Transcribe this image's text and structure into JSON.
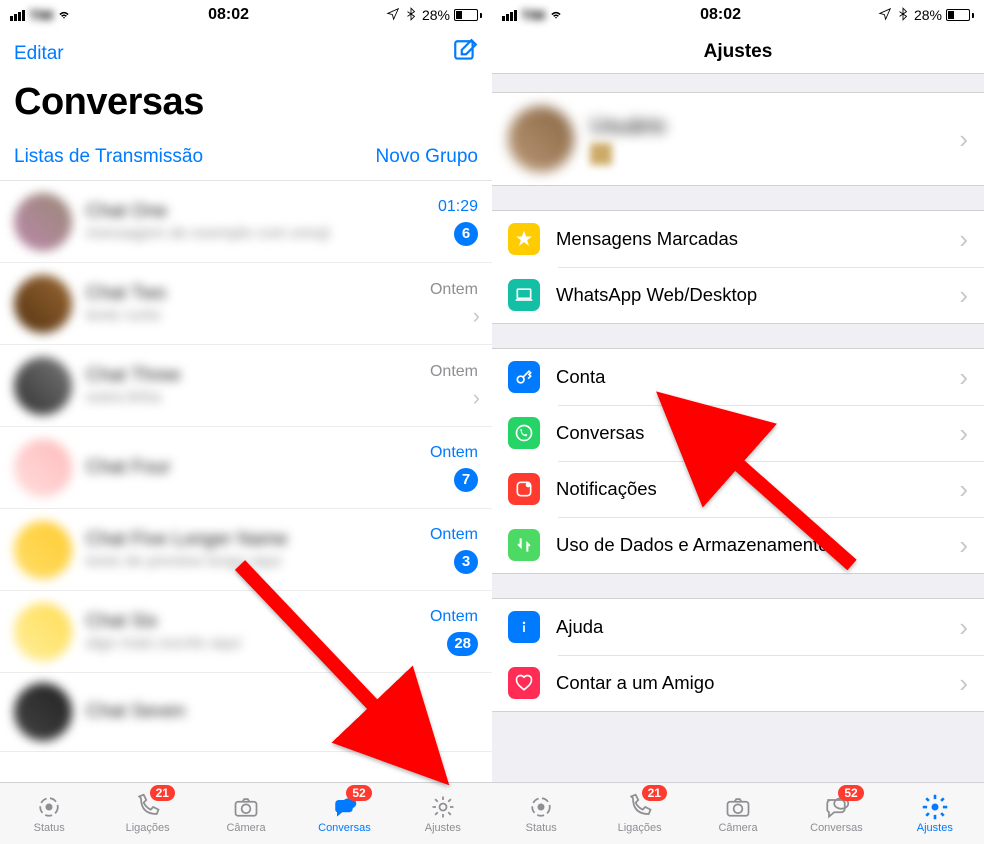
{
  "status": {
    "carrier": "TIM",
    "time": "08:02",
    "battery_pct": "28%"
  },
  "left_screen": {
    "edit": "Editar",
    "title": "Conversas",
    "broadcast": "Listas de Transmissão",
    "newgroup": "Novo Grupo",
    "chats": [
      {
        "name": "Chat One",
        "preview": "mensagem de exemplo com emoji",
        "time": "01:29",
        "unread": 6,
        "read": false
      },
      {
        "name": "Chat Two",
        "preview": "texto curto",
        "time": "Ontem",
        "unread": 0,
        "read": true
      },
      {
        "name": "Chat Three",
        "preview": "outra linha",
        "time": "Ontem",
        "unread": 0,
        "read": true
      },
      {
        "name": "Chat Four",
        "preview": "",
        "time": "Ontem",
        "unread": 7,
        "read": false
      },
      {
        "name": "Chat Five Longer Name",
        "preview": "texto de preview longo aqui",
        "time": "Ontem",
        "unread": 3,
        "read": false
      },
      {
        "name": "Chat Six",
        "preview": "algo mais escrito aqui",
        "time": "Ontem",
        "unread": 28,
        "read": false
      },
      {
        "name": "Chat Seven",
        "preview": "",
        "time": "",
        "unread": 0,
        "read": true
      }
    ]
  },
  "right_screen": {
    "title": "Ajustes",
    "profile_name": "Usuário",
    "items": {
      "starred": "Mensagens Marcadas",
      "web": "WhatsApp Web/Desktop",
      "account": "Conta",
      "chats": "Conversas",
      "notifications": "Notificações",
      "data": "Uso de Dados e Armazenamento",
      "help": "Ajuda",
      "tell": "Contar a um Amigo"
    }
  },
  "tabs": {
    "status": "Status",
    "calls": "Ligações",
    "calls_badge": "21",
    "camera": "Câmera",
    "chats": "Conversas",
    "chats_badge": "52",
    "settings": "Ajustes"
  }
}
